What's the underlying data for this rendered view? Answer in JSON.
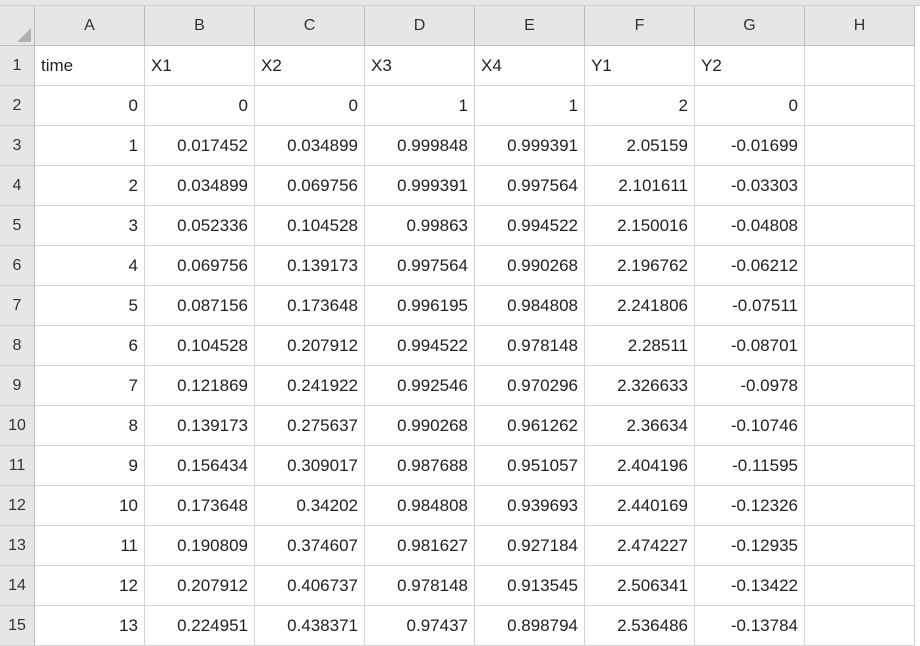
{
  "columns": [
    "A",
    "B",
    "C",
    "D",
    "E",
    "F",
    "G",
    "H"
  ],
  "row_numbers": [
    1,
    2,
    3,
    4,
    5,
    6,
    7,
    8,
    9,
    10,
    11,
    12,
    13,
    14,
    15
  ],
  "headers": {
    "A": "time",
    "B": "X1",
    "C": "X2",
    "D": "X3",
    "E": "X4",
    "F": "Y1",
    "G": "Y2",
    "H": ""
  },
  "rows": [
    {
      "A": "0",
      "B": "0",
      "C": "0",
      "D": "1",
      "E": "1",
      "F": "2",
      "G": "0",
      "H": ""
    },
    {
      "A": "1",
      "B": "0.017452",
      "C": "0.034899",
      "D": "0.999848",
      "E": "0.999391",
      "F": "2.05159",
      "G": "-0.01699",
      "H": ""
    },
    {
      "A": "2",
      "B": "0.034899",
      "C": "0.069756",
      "D": "0.999391",
      "E": "0.997564",
      "F": "2.101611",
      "G": "-0.03303",
      "H": ""
    },
    {
      "A": "3",
      "B": "0.052336",
      "C": "0.104528",
      "D": "0.99863",
      "E": "0.994522",
      "F": "2.150016",
      "G": "-0.04808",
      "H": ""
    },
    {
      "A": "4",
      "B": "0.069756",
      "C": "0.139173",
      "D": "0.997564",
      "E": "0.990268",
      "F": "2.196762",
      "G": "-0.06212",
      "H": ""
    },
    {
      "A": "5",
      "B": "0.087156",
      "C": "0.173648",
      "D": "0.996195",
      "E": "0.984808",
      "F": "2.241806",
      "G": "-0.07511",
      "H": ""
    },
    {
      "A": "6",
      "B": "0.104528",
      "C": "0.207912",
      "D": "0.994522",
      "E": "0.978148",
      "F": "2.28511",
      "G": "-0.08701",
      "H": ""
    },
    {
      "A": "7",
      "B": "0.121869",
      "C": "0.241922",
      "D": "0.992546",
      "E": "0.970296",
      "F": "2.326633",
      "G": "-0.0978",
      "H": ""
    },
    {
      "A": "8",
      "B": "0.139173",
      "C": "0.275637",
      "D": "0.990268",
      "E": "0.961262",
      "F": "2.36634",
      "G": "-0.10746",
      "H": ""
    },
    {
      "A": "9",
      "B": "0.156434",
      "C": "0.309017",
      "D": "0.987688",
      "E": "0.951057",
      "F": "2.404196",
      "G": "-0.11595",
      "H": ""
    },
    {
      "A": "10",
      "B": "0.173648",
      "C": "0.34202",
      "D": "0.984808",
      "E": "0.939693",
      "F": "2.440169",
      "G": "-0.12326",
      "H": ""
    },
    {
      "A": "11",
      "B": "0.190809",
      "C": "0.374607",
      "D": "0.981627",
      "E": "0.927184",
      "F": "2.474227",
      "G": "-0.12935",
      "H": ""
    },
    {
      "A": "12",
      "B": "0.207912",
      "C": "0.406737",
      "D": "0.978148",
      "E": "0.913545",
      "F": "2.506341",
      "G": "-0.13422",
      "H": ""
    },
    {
      "A": "13",
      "B": "0.224951",
      "C": "0.438371",
      "D": "0.97437",
      "E": "0.898794",
      "F": "2.536486",
      "G": "-0.13784",
      "H": ""
    }
  ]
}
